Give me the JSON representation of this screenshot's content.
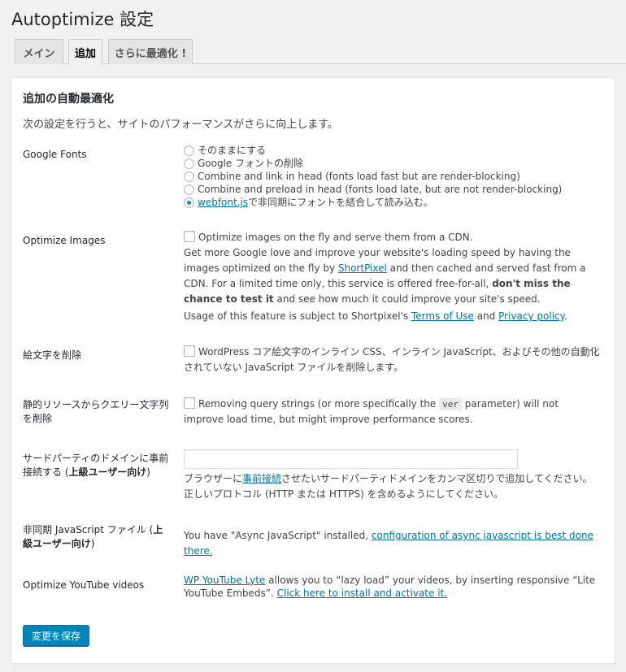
{
  "page_title": "Autoptimize 設定",
  "tabs": [
    {
      "label": "メイン"
    },
    {
      "label": "追加"
    },
    {
      "label": "さらに最適化 !"
    }
  ],
  "panel": {
    "heading": "追加の自動最適化",
    "intro": "次の設定を行うと、サイトのパフォーマンスがさらに向上します。"
  },
  "google_fonts": {
    "label": "Google Fonts",
    "options": [
      "そのままにする",
      "Google フォントの削除",
      "Combine and link in head (fonts load fast but are render-blocking)",
      "Combine and preload in head (fonts load late, but are not render-blocking)"
    ],
    "webfont_link": "webfont.js",
    "webfont_rest": " で非同期にフォントを結合して読み込む。",
    "selected_index": 4
  },
  "optimize_images": {
    "label": "Optimize Images",
    "checkbox_label": "Optimize images on the fly and serve them from a CDN.",
    "desc_1": "Get more Google love and improve your website's loading speed by having the images optimized on the fly by ",
    "shortpixel_link": "ShortPixel",
    "desc_2": " and then cached and served fast from a CDN. For a limited time only, this service is offered free-for-all, ",
    "desc_bold": "don't miss the chance to test it",
    "desc_3": " and see how much it could improve your site's speed.",
    "usage_1": "Usage of this feature is subject to Shortpixel's ",
    "terms_link": "Terms of Use",
    "usage_and": " and ",
    "privacy_link": "Privacy policy",
    "usage_end": "."
  },
  "emoji": {
    "label": "絵文字を削除",
    "checkbox_label": "WordPress コア絵文字のインライン CSS、インライン JavaScript、およびその他の自動化されていない JavaScript ファイルを削除します。"
  },
  "query_strings": {
    "label": "静的リソースからクエリー文字列を削除",
    "text_1": "Removing query strings (or more specifically the ",
    "code": "ver",
    "text_2": " parameter) will not improve load time, but might improve performance scores."
  },
  "preconnect": {
    "label_1": "サードパーティのドメインに事前接続する (",
    "label_bold": "上級ユーザー向け",
    "label_2": ")",
    "input_value": "",
    "desc_1": "ブラウザーに",
    "desc_link": "事前接続",
    "desc_2": "させたいサードパーティドメインをカンマ区切りで追加してください。正しいプロトコル (HTTP または HTTPS) を含めるようにしてください。"
  },
  "async_js": {
    "label_1": "非同期 JavaScript ファイル (",
    "label_bold": "上級ユーザー向け",
    "label_2": ")",
    "text": "You have \"Async JavaScript\" installed, ",
    "link": "configuration of async javascript is best done there."
  },
  "youtube": {
    "label": "Optimize YouTube videos",
    "link_1": "WP YouTube Lyte",
    "text": " allows you to “lazy load” your videos, by inserting responsive “Lite YouTube Embeds”. ",
    "link_2": "Click here to install and activate it."
  },
  "save_button": "変更を保存"
}
